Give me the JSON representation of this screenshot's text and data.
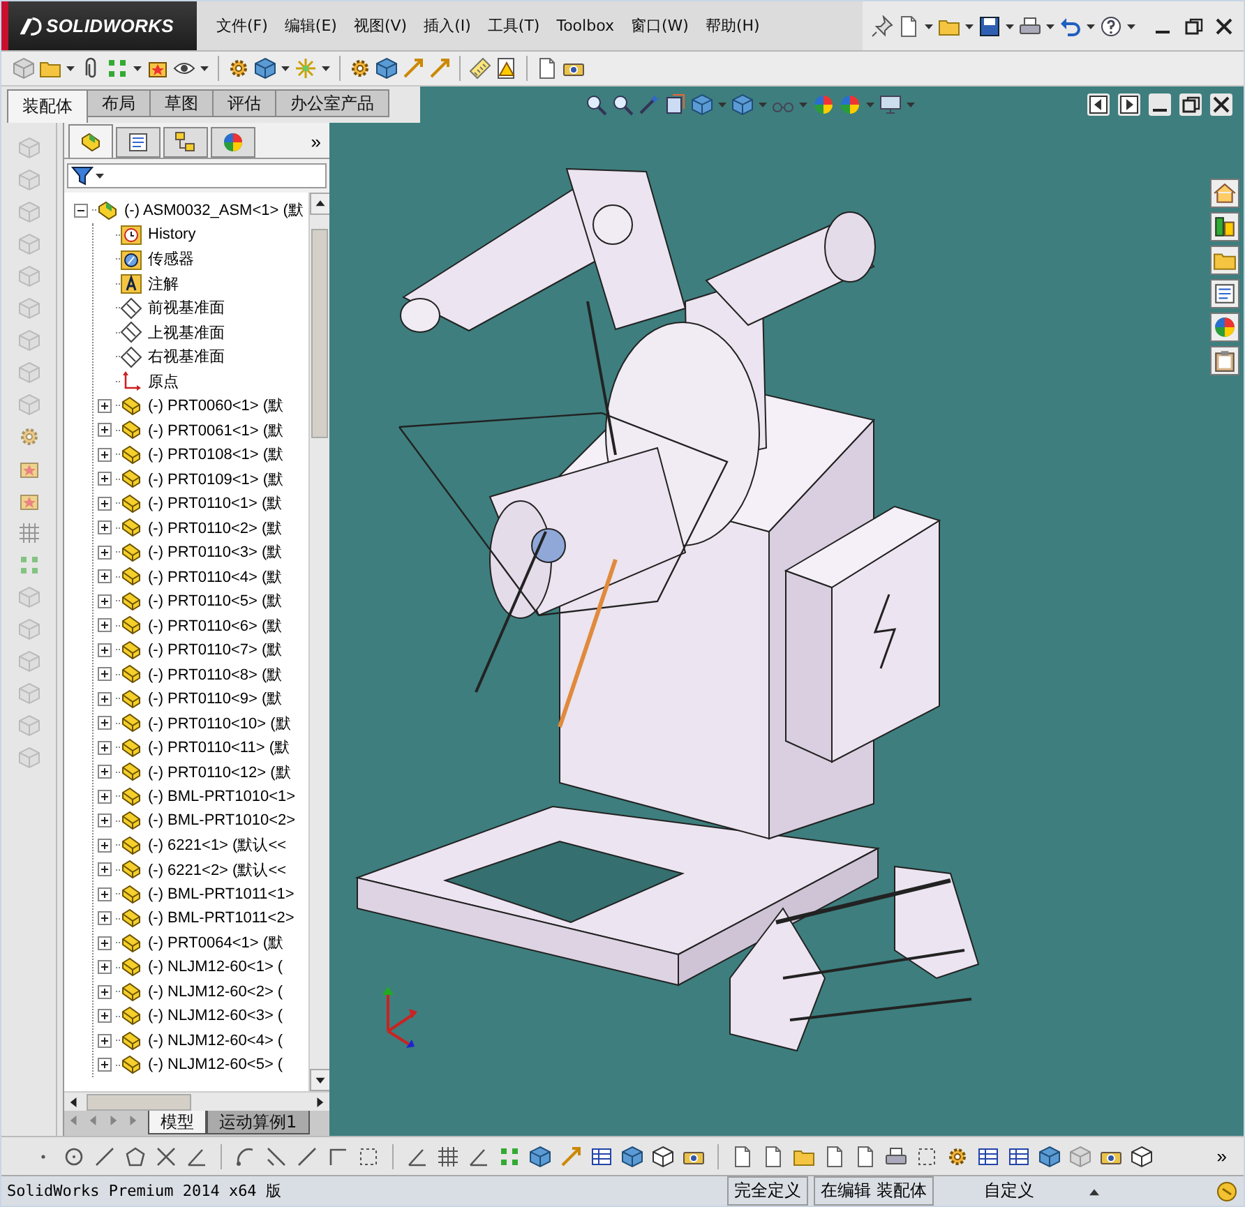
{
  "app": {
    "logo": "SOLIDWORKS"
  },
  "menu": [
    "文件(F)",
    "编辑(E)",
    "视图(V)",
    "插入(I)",
    "工具(T)",
    "Toolbox",
    "窗口(W)",
    "帮助(H)"
  ],
  "command_tabs": [
    {
      "label": "装配体",
      "selected": true
    },
    {
      "label": "布局",
      "selected": false
    },
    {
      "label": "草图",
      "selected": false
    },
    {
      "label": "评估",
      "selected": false
    },
    {
      "label": "办公室产品",
      "selected": false
    }
  ],
  "panel_tabs_more": "»",
  "feature_tree": {
    "root": {
      "label": "(-) ASM0032_ASM<1> (默",
      "kind": "assembly",
      "expanded": true,
      "children": [
        {
          "label": "History",
          "kind": "history"
        },
        {
          "label": "传感器",
          "kind": "sensor"
        },
        {
          "label": "注解",
          "kind": "annotation"
        },
        {
          "label": "前视基准面",
          "kind": "plane"
        },
        {
          "label": "上视基准面",
          "kind": "plane"
        },
        {
          "label": "右视基准面",
          "kind": "plane"
        },
        {
          "label": "原点",
          "kind": "origin"
        },
        {
          "label": "(-) PRT0060<1> (默",
          "kind": "part",
          "expanded": false
        },
        {
          "label": "(-) PRT0061<1> (默",
          "kind": "part",
          "expanded": false
        },
        {
          "label": "(-) PRT0108<1> (默",
          "kind": "part",
          "expanded": false
        },
        {
          "label": "(-) PRT0109<1> (默",
          "kind": "part",
          "expanded": false
        },
        {
          "label": "(-) PRT0110<1> (默",
          "kind": "part",
          "expanded": false
        },
        {
          "label": "(-) PRT0110<2> (默",
          "kind": "part",
          "expanded": false
        },
        {
          "label": "(-) PRT0110<3> (默",
          "kind": "part",
          "expanded": false
        },
        {
          "label": "(-) PRT0110<4> (默",
          "kind": "part",
          "expanded": false
        },
        {
          "label": "(-) PRT0110<5> (默",
          "kind": "part",
          "expanded": false
        },
        {
          "label": "(-) PRT0110<6> (默",
          "kind": "part",
          "expanded": false
        },
        {
          "label": "(-) PRT0110<7> (默",
          "kind": "part",
          "expanded": false
        },
        {
          "label": "(-) PRT0110<8> (默",
          "kind": "part",
          "expanded": false
        },
        {
          "label": "(-) PRT0110<9> (默",
          "kind": "part",
          "expanded": false
        },
        {
          "label": "(-) PRT0110<10> (默",
          "kind": "part",
          "expanded": false
        },
        {
          "label": "(-) PRT0110<11> (默",
          "kind": "part",
          "expanded": false
        },
        {
          "label": "(-) PRT0110<12> (默",
          "kind": "part",
          "expanded": false
        },
        {
          "label": "(-) BML-PRT1010<1>",
          "kind": "part",
          "expanded": false
        },
        {
          "label": "(-) BML-PRT1010<2>",
          "kind": "part",
          "expanded": false
        },
        {
          "label": "(-) 6221<1> (默认<<",
          "kind": "part",
          "expanded": false
        },
        {
          "label": "(-) 6221<2> (默认<<",
          "kind": "part",
          "expanded": false
        },
        {
          "label": "(-) BML-PRT1011<1>",
          "kind": "part",
          "expanded": false
        },
        {
          "label": "(-) BML-PRT1011<2>",
          "kind": "part",
          "expanded": false
        },
        {
          "label": "(-) PRT0064<1> (默",
          "kind": "part",
          "expanded": false
        },
        {
          "label": "(-) NLJM12-60<1> (",
          "kind": "part",
          "expanded": false
        },
        {
          "label": "(-) NLJM12-60<2> (",
          "kind": "part",
          "expanded": false
        },
        {
          "label": "(-) NLJM12-60<3> (",
          "kind": "part",
          "expanded": false
        },
        {
          "label": "(-) NLJM12-60<4> (",
          "kind": "part",
          "expanded": false
        },
        {
          "label": "(-) NLJM12-60<5> (",
          "kind": "part",
          "expanded": false
        }
      ]
    }
  },
  "bottom_tabs": [
    {
      "label": "模型",
      "selected": true
    },
    {
      "label": "运动算例1",
      "selected": false
    }
  ],
  "bottom_toolbar_more": "»",
  "status_bar": {
    "product": "SolidWorks Premium 2014 x64 版",
    "fields": [
      "完全定义",
      "在编辑 装配体",
      "自定义"
    ]
  }
}
